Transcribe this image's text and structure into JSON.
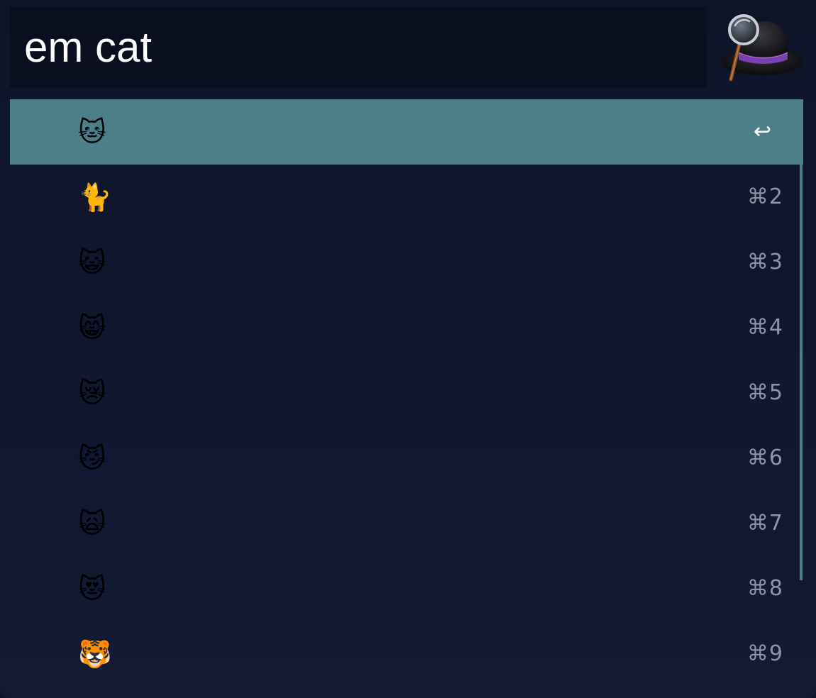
{
  "search": {
    "query": "em cat"
  },
  "app_icon": "alfred-hat-magnifier-icon",
  "results": [
    {
      "emoji": "🐱",
      "shortcut": "↩"
    },
    {
      "emoji": "🐈",
      "shortcut": "⌘2"
    },
    {
      "emoji": "😺",
      "shortcut": "⌘3"
    },
    {
      "emoji": "😸",
      "shortcut": "⌘4"
    },
    {
      "emoji": "😿",
      "shortcut": "⌘5"
    },
    {
      "emoji": "😼",
      "shortcut": "⌘6"
    },
    {
      "emoji": "🙀",
      "shortcut": "⌘7"
    },
    {
      "emoji": "😻",
      "shortcut": "⌘8"
    },
    {
      "emoji": "🐯",
      "shortcut": "⌘9"
    }
  ],
  "colors": {
    "background": "#111731",
    "search_field": "#0a0f1f",
    "selection": "#4c7f8a",
    "shortcut_text": "#8e94a6"
  }
}
